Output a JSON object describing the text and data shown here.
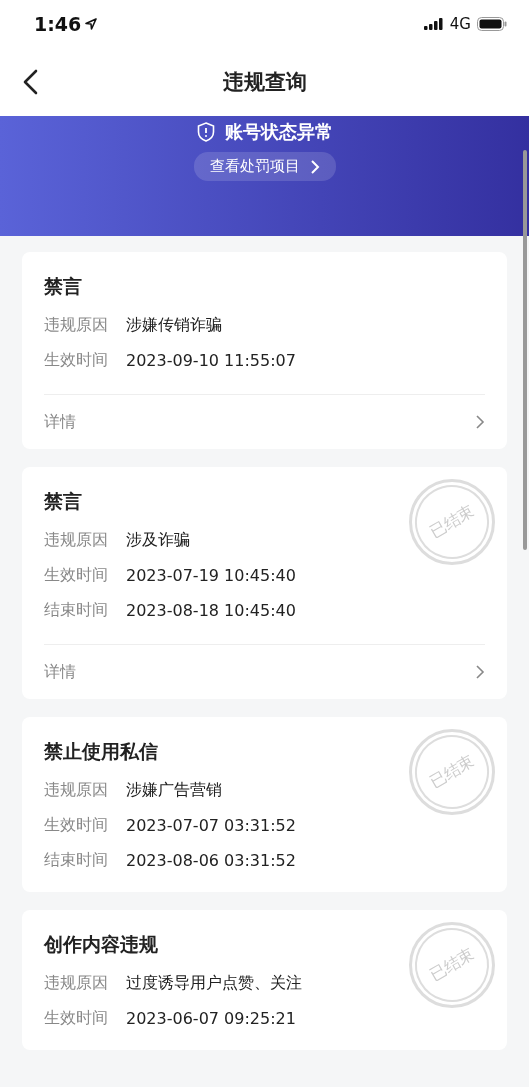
{
  "status_bar": {
    "time": "1:46",
    "network": "4G"
  },
  "nav": {
    "title": "违规查询"
  },
  "banner": {
    "status": "账号状态异常",
    "button": "查看处罚项目"
  },
  "records": [
    {
      "title": "禁言",
      "fields": [
        {
          "label": "违规原因",
          "value": "涉嫌传销诈骗"
        },
        {
          "label": "生效时间",
          "value": "2023-09-10 11:55:07"
        }
      ],
      "details": "详情"
    },
    {
      "title": "禁言",
      "stamp": "已结束",
      "fields": [
        {
          "label": "违规原因",
          "value": "涉及诈骗"
        },
        {
          "label": "生效时间",
          "value": "2023-07-19 10:45:40"
        },
        {
          "label": "结束时间",
          "value": "2023-08-18 10:45:40"
        }
      ],
      "details": "详情"
    },
    {
      "title": "禁止使用私信",
      "stamp": "已结束",
      "fields": [
        {
          "label": "违规原因",
          "value": "涉嫌广告营销"
        },
        {
          "label": "生效时间",
          "value": "2023-07-07 03:31:52"
        },
        {
          "label": "结束时间",
          "value": "2023-08-06 03:31:52"
        }
      ]
    },
    {
      "title": "创作内容违规",
      "stamp": "已结束",
      "fields": [
        {
          "label": "违规原因",
          "value": "过度诱导用户点赞、关注"
        },
        {
          "label": "生效时间",
          "value": "2023-06-07 09:25:21"
        }
      ]
    }
  ]
}
